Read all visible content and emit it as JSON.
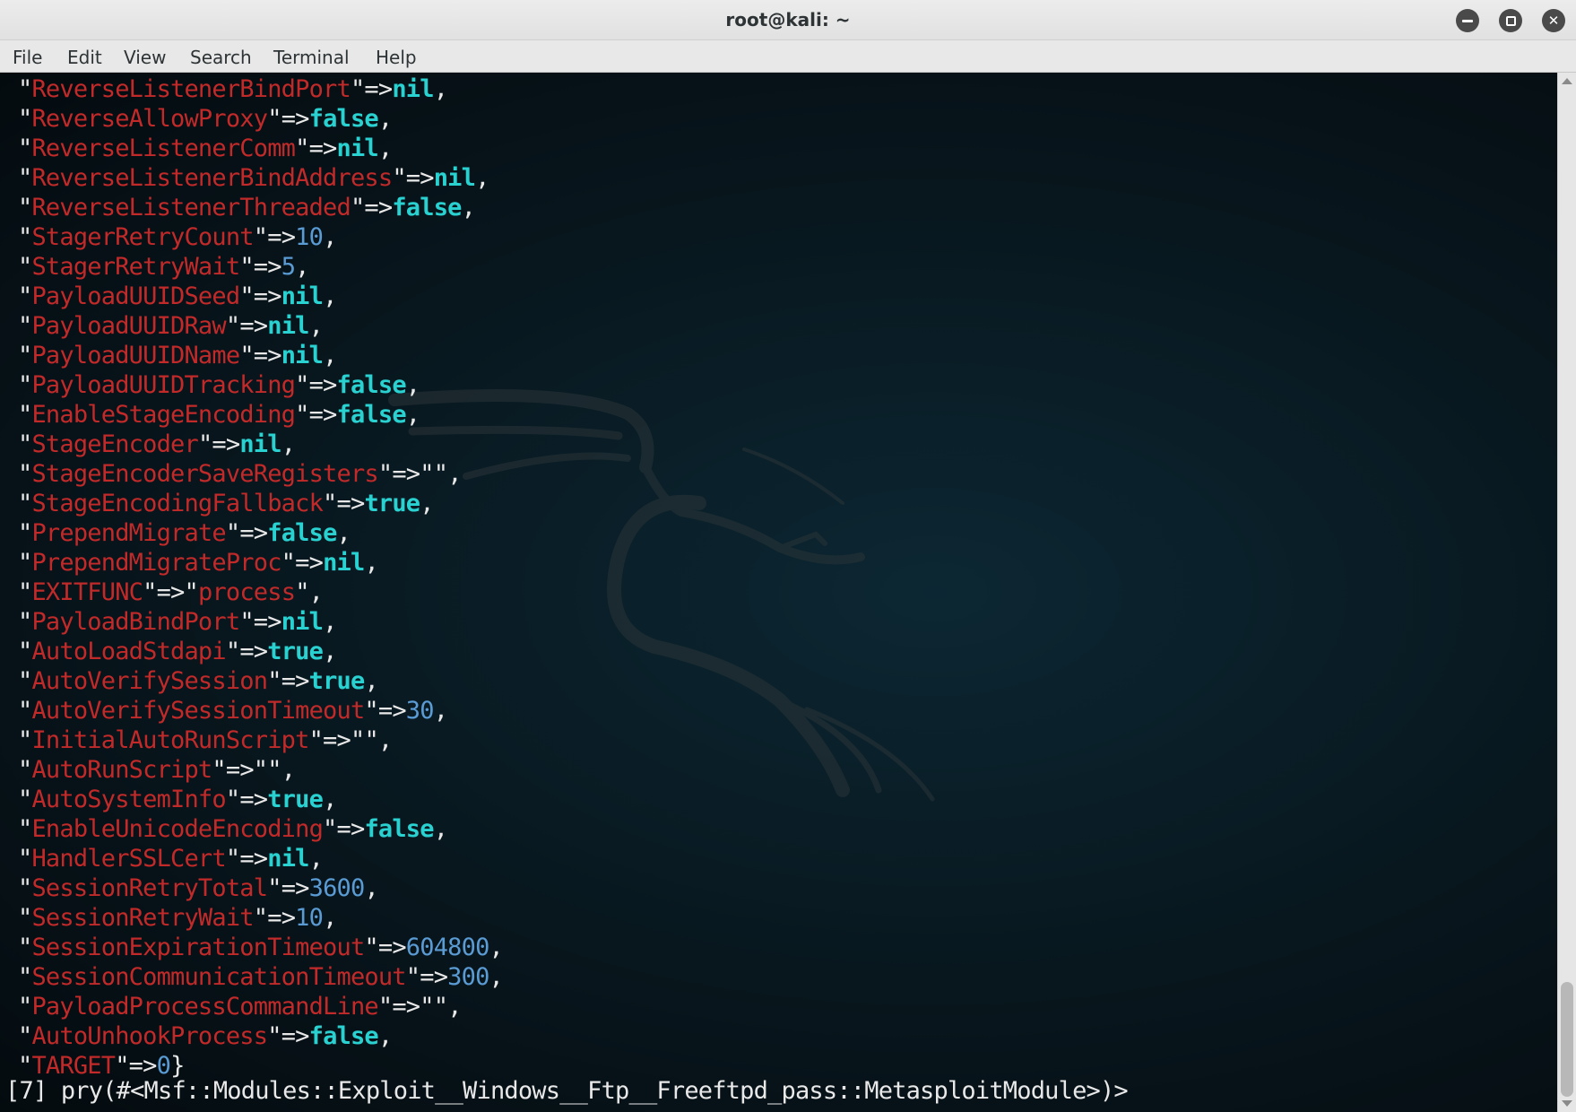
{
  "window": {
    "title": "root@kali: ~"
  },
  "window_controls": {
    "minimize_icon": "minimize-icon",
    "maximize_icon": "maximize-icon",
    "close_icon": "close-icon"
  },
  "menu": [
    "File",
    "Edit",
    "View",
    "Search",
    "Terminal",
    "Help"
  ],
  "colors": {
    "key": "#c22a2a",
    "literal": "#2ad1d1",
    "number": "#5a9bd4",
    "background": "#08161d"
  },
  "terminal": {
    "entries": [
      {
        "key": "ReverseListenerBindPort",
        "value": "nil",
        "type": "lit",
        "end": ","
      },
      {
        "key": "ReverseAllowProxy",
        "value": "false",
        "type": "lit",
        "end": ","
      },
      {
        "key": "ReverseListenerComm",
        "value": "nil",
        "type": "lit",
        "end": ","
      },
      {
        "key": "ReverseListenerBindAddress",
        "value": "nil",
        "type": "lit",
        "end": ","
      },
      {
        "key": "ReverseListenerThreaded",
        "value": "false",
        "type": "lit",
        "end": ","
      },
      {
        "key": "StagerRetryCount",
        "value": "10",
        "type": "num",
        "end": ","
      },
      {
        "key": "StagerRetryWait",
        "value": "5",
        "type": "num",
        "end": ","
      },
      {
        "key": "PayloadUUIDSeed",
        "value": "nil",
        "type": "lit",
        "end": ","
      },
      {
        "key": "PayloadUUIDRaw",
        "value": "nil",
        "type": "lit",
        "end": ","
      },
      {
        "key": "PayloadUUIDName",
        "value": "nil",
        "type": "lit",
        "end": ","
      },
      {
        "key": "PayloadUUIDTracking",
        "value": "false",
        "type": "lit",
        "end": ","
      },
      {
        "key": "EnableStageEncoding",
        "value": "false",
        "type": "lit",
        "end": ","
      },
      {
        "key": "StageEncoder",
        "value": "nil",
        "type": "lit",
        "end": ","
      },
      {
        "key": "StageEncoderSaveRegisters",
        "value": "",
        "type": "str",
        "end": ","
      },
      {
        "key": "StageEncodingFallback",
        "value": "true",
        "type": "lit",
        "end": ","
      },
      {
        "key": "PrependMigrate",
        "value": "false",
        "type": "lit",
        "end": ","
      },
      {
        "key": "PrependMigrateProc",
        "value": "nil",
        "type": "lit",
        "end": ","
      },
      {
        "key": "EXITFUNC",
        "value": "process",
        "type": "str",
        "end": ","
      },
      {
        "key": "PayloadBindPort",
        "value": "nil",
        "type": "lit",
        "end": ","
      },
      {
        "key": "AutoLoadStdapi",
        "value": "true",
        "type": "lit",
        "end": ","
      },
      {
        "key": "AutoVerifySession",
        "value": "true",
        "type": "lit",
        "end": ","
      },
      {
        "key": "AutoVerifySessionTimeout",
        "value": "30",
        "type": "num",
        "end": ","
      },
      {
        "key": "InitialAutoRunScript",
        "value": "",
        "type": "str",
        "end": ","
      },
      {
        "key": "AutoRunScript",
        "value": "",
        "type": "str",
        "end": ","
      },
      {
        "key": "AutoSystemInfo",
        "value": "true",
        "type": "lit",
        "end": ","
      },
      {
        "key": "EnableUnicodeEncoding",
        "value": "false",
        "type": "lit",
        "end": ","
      },
      {
        "key": "HandlerSSLCert",
        "value": "nil",
        "type": "lit",
        "end": ","
      },
      {
        "key": "SessionRetryTotal",
        "value": "3600",
        "type": "num",
        "end": ","
      },
      {
        "key": "SessionRetryWait",
        "value": "10",
        "type": "num",
        "end": ","
      },
      {
        "key": "SessionExpirationTimeout",
        "value": "604800",
        "type": "num",
        "end": ","
      },
      {
        "key": "SessionCommunicationTimeout",
        "value": "300",
        "type": "num",
        "end": ","
      },
      {
        "key": "PayloadProcessCommandLine",
        "value": "",
        "type": "str",
        "end": ","
      },
      {
        "key": "AutoUnhookProcess",
        "value": "false",
        "type": "lit",
        "end": ","
      },
      {
        "key": "TARGET",
        "value": "0",
        "type": "num",
        "end": "}"
      }
    ],
    "prompt": "[7] pry(#<Msf::Modules::Exploit__Windows__Ftp__Freeftpd_pass::MetasploitModule>)>"
  },
  "scrollbar": {
    "position": 0.91
  }
}
